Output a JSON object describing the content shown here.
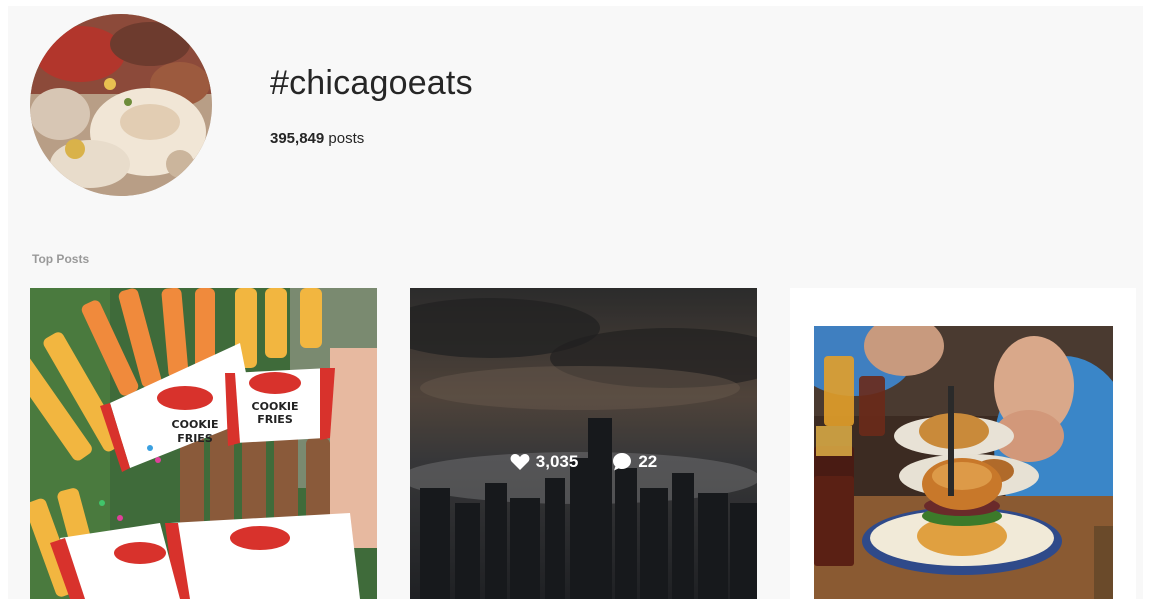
{
  "header": {
    "hashtag": "#chicagoeats",
    "post_count": "395,849",
    "post_count_suffix": "posts"
  },
  "sections": {
    "top_posts_label": "Top Posts"
  },
  "posts": [
    {
      "subject": "cookie fries in paper cups",
      "cup_text_1": "COOKIE",
      "cup_text_2": "FRIES"
    },
    {
      "subject": "chicago skyline under clouds",
      "likes": "3,035",
      "comments": "22"
    },
    {
      "subject": "burger on plate at restaurant table"
    }
  ],
  "icons": {
    "likes": "heart-icon",
    "comments": "comment-icon"
  },
  "colors": {
    "background": "#f8f8f8",
    "text": "#262626",
    "muted": "#999999",
    "overlay_text": "#ffffff"
  }
}
